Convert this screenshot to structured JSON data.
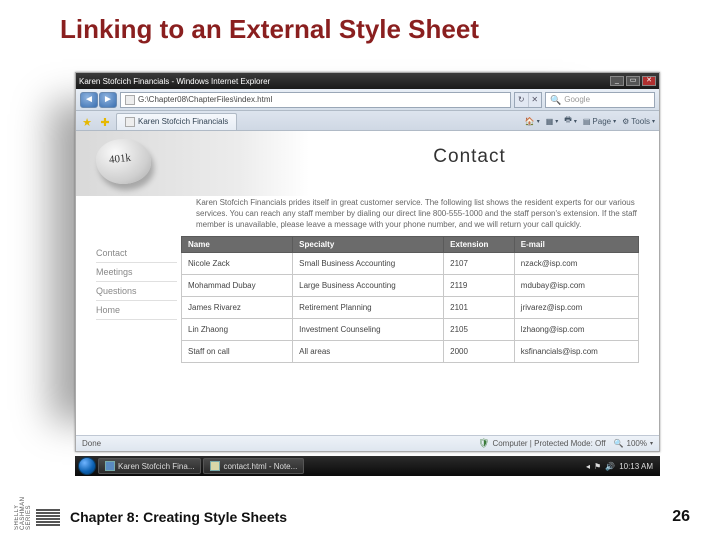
{
  "slide": {
    "title": "Linking to an External Style Sheet",
    "chapter": "Chapter 8: Creating Style Sheets",
    "page_number": "26"
  },
  "browser": {
    "window_title": "Karen Stofcich Financials - Windows Internet Explorer",
    "address": "G:\\Chapter08\\ChapterFiles\\index.html",
    "search_placeholder": "Google",
    "tab_label": "Karen Stofcich Financials",
    "tool_home": "",
    "tool_print": "",
    "tool_page": "Page",
    "tool_tools": "Tools",
    "status_done": "Done",
    "status_zone": "Computer | Protected Mode: Off",
    "status_zoom": "100%"
  },
  "page": {
    "stone_label": "401k",
    "heading": "Contact",
    "intro": "Karen Stofcich Financials prides itself in great customer service. The following list shows the resident experts for our various services. You can reach any staff member by dialing our direct line 800-555-1000 and the staff person's extension. If the staff member is unavailable, please leave a message with your phone number, and we will return your call quickly.",
    "nav": [
      "Contact",
      "Meetings",
      "Questions",
      "Home"
    ],
    "table": {
      "headers": [
        "Name",
        "Specialty",
        "Extension",
        "E-mail"
      ],
      "rows": [
        [
          "Nicole Zack",
          "Small Business Accounting",
          "2107",
          "nzack@isp.com"
        ],
        [
          "Mohammad Dubay",
          "Large Business Accounting",
          "2119",
          "mdubay@isp.com"
        ],
        [
          "James Rivarez",
          "Retirement Planning",
          "2101",
          "jrivarez@isp.com"
        ],
        [
          "Lin Zhaong",
          "Investment Counseling",
          "2105",
          "lzhaong@isp.com"
        ],
        [
          "Staff on call",
          "All areas",
          "2000",
          "ksfinancials@isp.com"
        ]
      ]
    }
  },
  "taskbar": {
    "items": [
      "Karen Stofcich Fina...",
      "contact.html - Note..."
    ],
    "clock": "10:13 AM"
  }
}
